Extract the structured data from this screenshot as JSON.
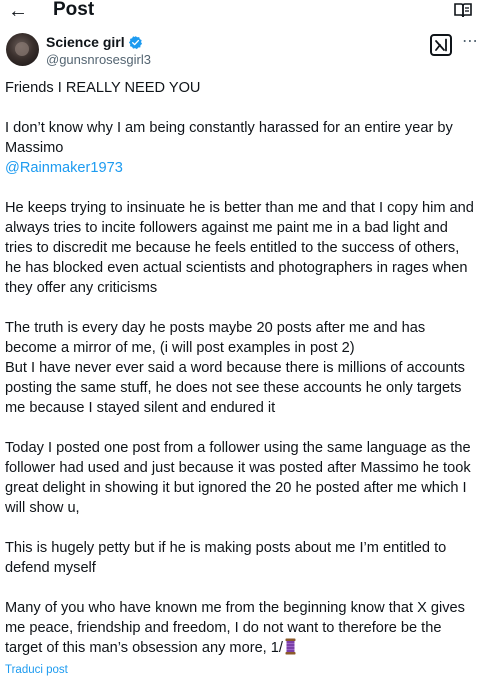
{
  "header": {
    "back_icon": "arrow-left-icon",
    "title": "Post",
    "reader_icon": "open-book-icon"
  },
  "author": {
    "name": "Science girl",
    "handle": "@gunsnrosesgirl3",
    "verified_icon": "verified-badge-icon",
    "verified_color": "#1d9bf0"
  },
  "actions": {
    "grok_icon": "grok-icon",
    "more_icon": "more-horizontal-icon"
  },
  "post": {
    "lines": {
      "l1": "Friends I REALLY NEED YOU",
      "l2": "I don’t know why I am being constantly harassed for an entire year by",
      "l3": "Massimo",
      "mention": "@Rainmaker1973",
      "l5": "He keeps trying to insinuate he is better than me and that I copy him and",
      "l6": "always tries to  incite followers against me paint me in a bad light and",
      "l7": "tries to discredit me because he feels entitled to the success of others,",
      "l8": "he has blocked even actual scientists and photographers in rages when",
      "l9": "they offer any criticisms",
      "l10": "The truth is every day he posts maybe 20 posts after me and has",
      "l11": "become a mirror of me, (i will post examples in post 2)",
      "l12": "But I have never ever said a word because there is millions of accounts",
      "l13": "posting the same stuff, he does not see these accounts he only targets",
      "l14": "me because I stayed silent and endured it",
      "l15": "Today I posted one post from a follower using the same language as the",
      "l16": "follower had used and just because it was posted after Massimo he took",
      "l17": "great delight in showing it but ignored the 20 he posted after me which I",
      "l18": "will show u,",
      "l19": "This is hugely petty but if he is making posts about me I’m entitled to",
      "l20": "defend myself",
      "l21": "Many of you who have known me from the beginning know that X gives",
      "l22": "me  peace, friendship and freedom, I do not want to therefore be the",
      "l23": "target of this man’s obsession any more,  1/"
    },
    "end_emoji": "thread-spool-emoji",
    "translate": "Traduci post"
  },
  "colors": {
    "text": "#0f1419",
    "secondary": "#536471",
    "link": "#1d9bf0"
  }
}
